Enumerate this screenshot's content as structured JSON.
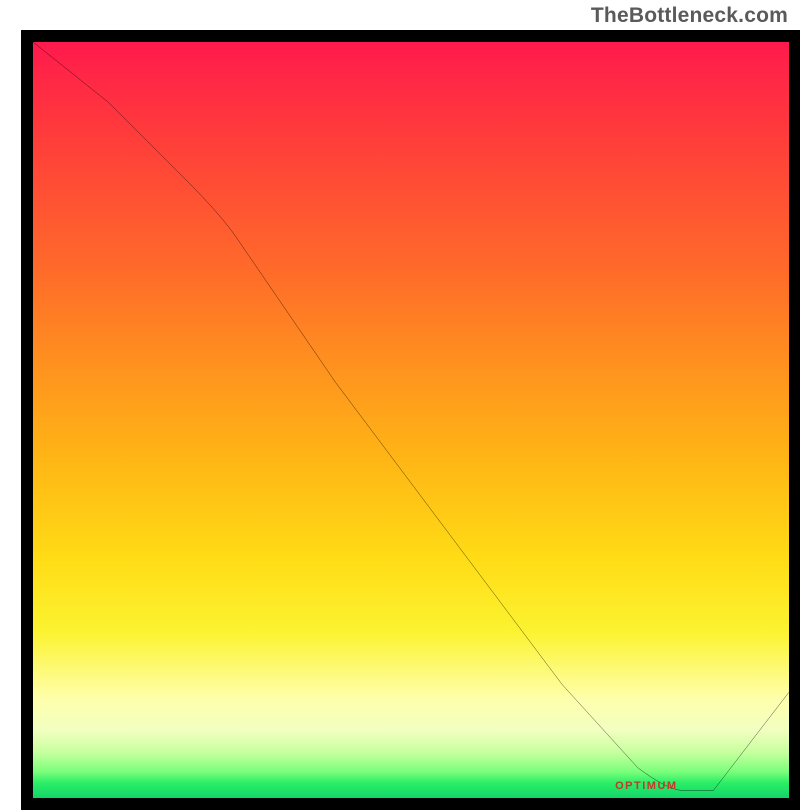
{
  "attribution": "TheBottleneck.com",
  "chart_data": {
    "type": "line",
    "title": "",
    "xlabel": "",
    "ylabel": "",
    "xlim": [
      0,
      100
    ],
    "ylim": [
      0,
      100
    ],
    "grid": false,
    "legend": false,
    "series": [
      {
        "name": "bottleneck-curve",
        "x": [
          0,
          10,
          20,
          27,
          40,
          55,
          70,
          80,
          86,
          90,
          100
        ],
        "y": [
          100,
          92,
          82,
          74,
          55,
          35,
          15,
          4,
          1,
          1,
          14
        ]
      }
    ],
    "annotations": [
      {
        "name": "optimum-marker",
        "text": "OPTIMUM",
        "x": 84,
        "y": 1.5
      }
    ],
    "background": "vertical-gradient red→yellow→green (green = optimum, bottom band)"
  }
}
